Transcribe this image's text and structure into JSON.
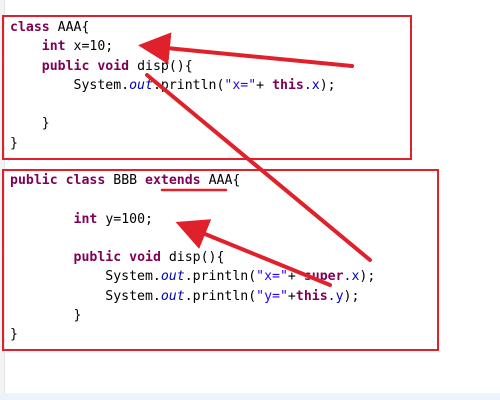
{
  "class_aaa": {
    "kw_class": "class",
    "name": "AAA{",
    "field_type": "int",
    "field_decl": "x=10;",
    "method_mod": "public",
    "method_type": "void",
    "method_sig": "disp(){",
    "print_system": "System.",
    "print_out": "out",
    "print_call": ".println(",
    "print_str": "\"x=\"",
    "print_plus": "+ ",
    "kw_this": "this",
    "print_field": ".x",
    "print_end": ");",
    "close_method": "}",
    "close_class": "}"
  },
  "class_bbb": {
    "kw_public": "public",
    "kw_class": "class",
    "name": "BBB",
    "kw_extends": "extends",
    "parent": "AAA{",
    "field_type": "int",
    "field_decl": "y=100;",
    "method_mod": "public",
    "method_type": "void",
    "method_sig": "disp(){",
    "line1_system": "System.",
    "line1_out": "out",
    "line1_call": ".println(",
    "line1_str": "\"x=\"",
    "line1_plus": "+ ",
    "kw_super": "super",
    "line1_field": ".x",
    "line1_end": ");",
    "line2_system": "System.",
    "line2_out": "out",
    "line2_call": ".println(",
    "line2_str": "\"y=\"",
    "line2_plus": "+",
    "kw_this": "this",
    "line2_field": ".y",
    "line2_end": ");",
    "close_method": "}",
    "close_class": "}"
  },
  "annotation_color": "#e0202a"
}
